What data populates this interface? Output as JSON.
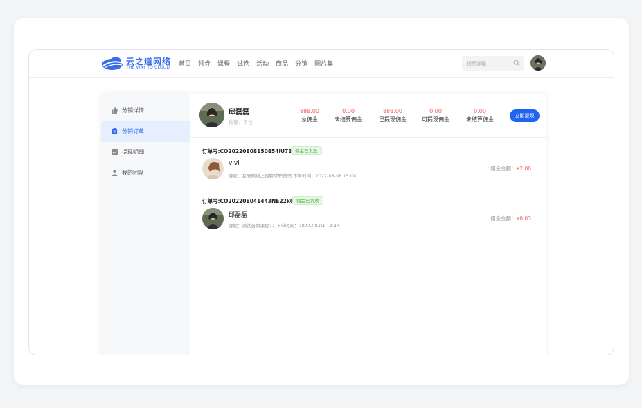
{
  "brand": {
    "name_cn": "云之道网络",
    "name_en": "THE WAY TO CLOUD",
    "color": "#3a6ee8"
  },
  "nav": {
    "items": [
      "首页",
      "领券",
      "课程",
      "试卷",
      "活动",
      "商品",
      "分销",
      "图片集"
    ]
  },
  "search": {
    "placeholder": "搜索课程",
    "icon": "search-icon"
  },
  "sidebar": {
    "items": [
      {
        "label": "分销详情",
        "icon": "thumbs-up-icon",
        "active": false
      },
      {
        "label": "分销订单",
        "icon": "clipboard-icon",
        "active": true
      },
      {
        "label": "提现明细",
        "icon": "chart-icon",
        "active": false
      },
      {
        "label": "我的团队",
        "icon": "person-icon",
        "active": false
      }
    ]
  },
  "profile": {
    "name": "邱磊磊",
    "referrer": "推荐：平台"
  },
  "stats": [
    {
      "value": "888.00",
      "label": "总佣金"
    },
    {
      "value": "0.00",
      "label": "未结算佣金"
    },
    {
      "value": "888.00",
      "label": "已提现佣金"
    },
    {
      "value": "0.00",
      "label": "可提现佣金"
    },
    {
      "value": "0.00",
      "label": "未结算佣金"
    }
  ],
  "withdraw_button": "立即提现",
  "orders": [
    {
      "order_no": "订单号:CO20220808150854iU71",
      "status": "佣金已发放",
      "buyer": "vivi",
      "desc": "课程：互联网线上招聘求职技巧,下单时间：2022-08-08 15:08",
      "commission_label": "佣金金额：",
      "commission_amount": "¥2.00"
    },
    {
      "order_no": "订单号:CO202208041443NE22k0",
      "status": "佣金已发放",
      "buyer": "邱磊磊",
      "desc": "课程：测试音频课程22,下单时间：2022-08-04 14:43",
      "commission_label": "佣金金额：",
      "commission_amount": "¥0.03"
    }
  ],
  "colors": {
    "accent": "#1f64f0",
    "money": "#f25b5b",
    "badge_green": "#55b04a",
    "active_menu_bg": "#e6effd"
  }
}
